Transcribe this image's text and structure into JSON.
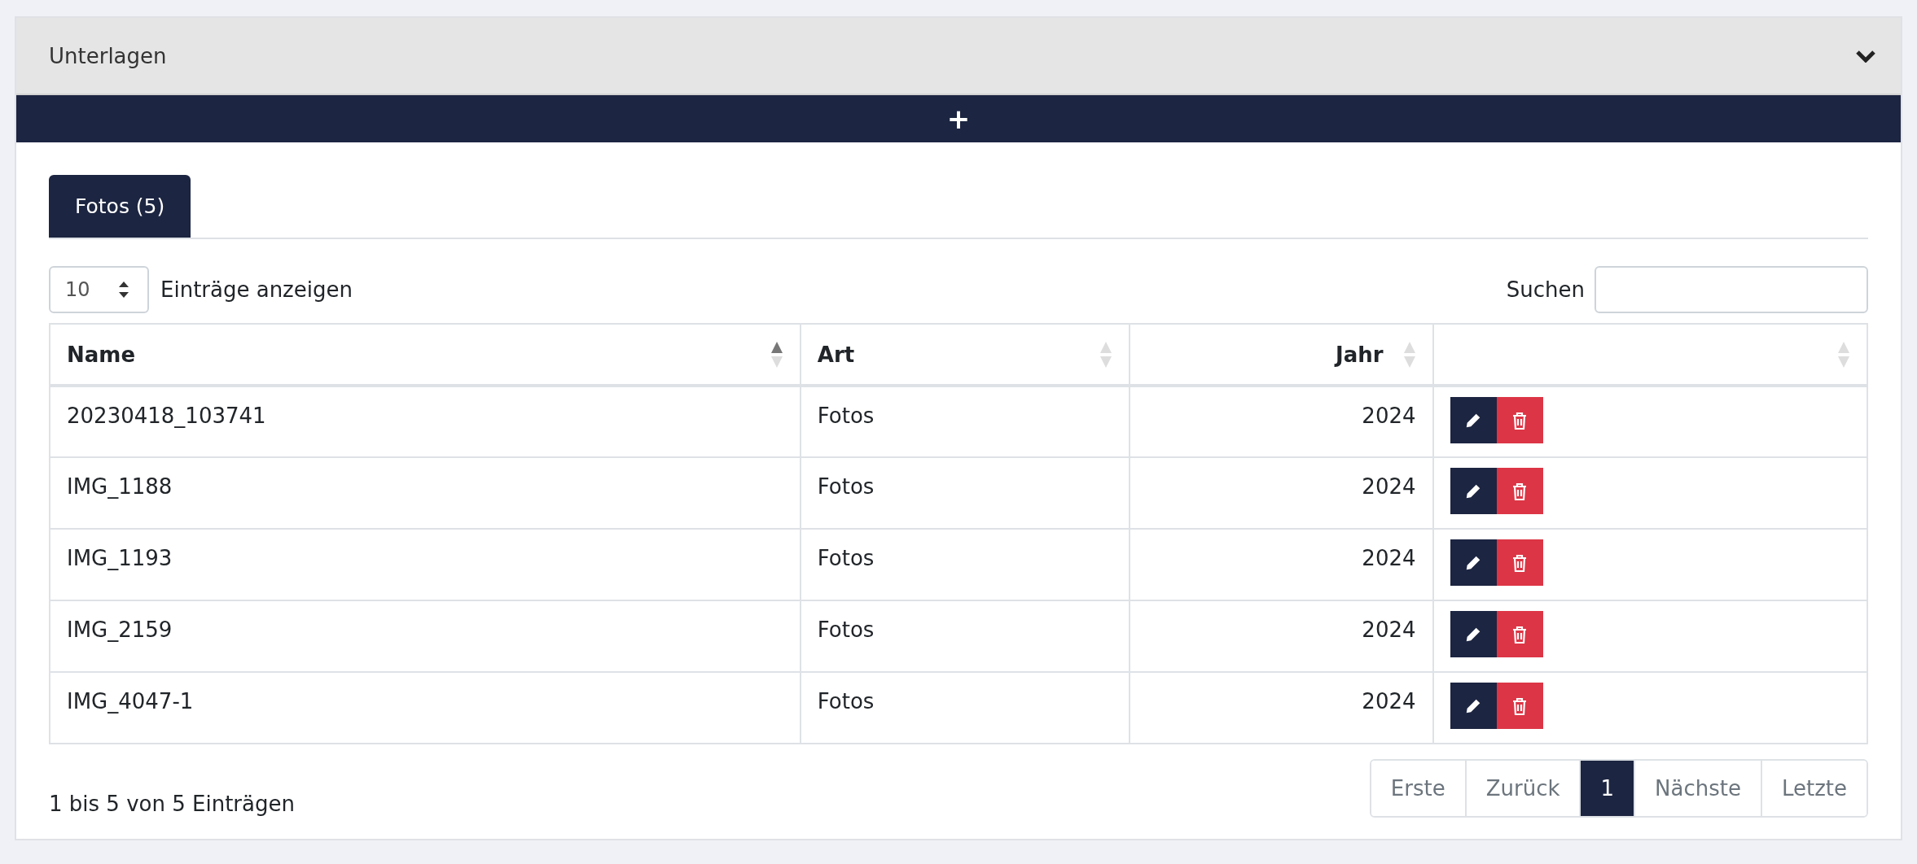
{
  "panel": {
    "title": "Unterlagen",
    "expanded": true,
    "add_label": "+"
  },
  "tabs": [
    {
      "label": "Fotos (5)",
      "selected": true
    }
  ],
  "length": {
    "value": "10",
    "label": "Einträge anzeigen"
  },
  "search": {
    "label": "Suchen"
  },
  "table": {
    "columns": [
      {
        "label": "Name",
        "sorted": true,
        "kind": "text"
      },
      {
        "label": "Art",
        "sorted": false,
        "kind": "text"
      },
      {
        "label": "Jahr",
        "sorted": false,
        "kind": "number"
      },
      {
        "sorted": false,
        "kind": "actions"
      }
    ],
    "rows": [
      {
        "name": "20230418_103741",
        "art": "Fotos",
        "jahr": "2024"
      },
      {
        "name": "IMG_1188",
        "art": "Fotos",
        "jahr": "2024"
      },
      {
        "name": "IMG_1193",
        "art": "Fotos",
        "jahr": "2024"
      },
      {
        "name": "IMG_2159",
        "art": "Fotos",
        "jahr": "2024"
      },
      {
        "name": "IMG_4047-1",
        "art": "Fotos",
        "jahr": "2024"
      }
    ]
  },
  "info": "1 bis 5 von 5 Einträgen",
  "pagination": [
    {
      "label": "Erste",
      "selected": false
    },
    {
      "label": "Zurück",
      "selected": false
    },
    {
      "label": "1",
      "selected": true
    },
    {
      "label": "Nächste",
      "selected": false
    },
    {
      "label": "Letzte",
      "selected": false
    }
  ]
}
